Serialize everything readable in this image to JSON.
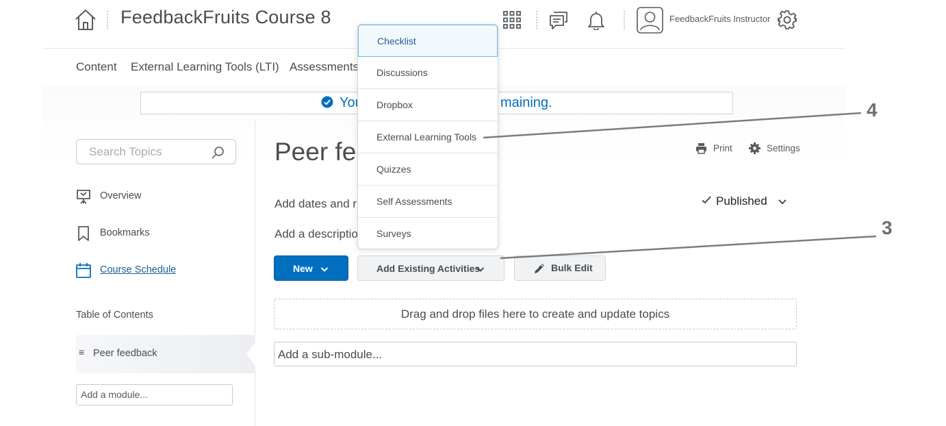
{
  "header": {
    "course_title": "FeedbackFruits Course 8",
    "username": "FeedbackFruits Instructor",
    "icons": [
      "home-icon",
      "waffle-grid-icon",
      "messages-icon",
      "notifications-bell-icon",
      "avatar",
      "gear-icon"
    ]
  },
  "nav": {
    "tabs": [
      "Content",
      "External Learning Tools (LTI)",
      "Assessments"
    ]
  },
  "notice": {
    "text_left": "You",
    "text_right": "maining."
  },
  "sidebar": {
    "search_placeholder": "Search Topics",
    "items": [
      {
        "label": "Overview",
        "icon": "presentation-icon"
      },
      {
        "label": "Bookmarks",
        "icon": "bookmark-icon"
      },
      {
        "label": "Course Schedule",
        "icon": "calendar-icon"
      }
    ],
    "toc_label": "Table of Contents",
    "toc_item": "Peer feedback",
    "add_module_placeholder": "Add a module..."
  },
  "main": {
    "title": "Peer fee",
    "print_label": "Print",
    "settings_label": "Settings",
    "dates_text": "Add dates and r",
    "description_text": "Add a descriptio",
    "status_label": "Published",
    "buttons": {
      "new": "New",
      "add_existing": "Add Existing Activities",
      "bulk_edit": "Bulk Edit"
    },
    "dropzone_text": "Drag and drop files here to create and update topics",
    "submodule_placeholder": "Add a sub-module..."
  },
  "menu": {
    "items": [
      "Checklist",
      "Discussions",
      "Dropbox",
      "External Learning Tools",
      "Quizzes",
      "Self Assessments",
      "Surveys"
    ],
    "active_index": 0
  },
  "annotations": [
    {
      "label": "4",
      "target": "External Learning Tools"
    },
    {
      "label": "3",
      "target": "Add Existing Activities"
    }
  ],
  "colors": {
    "primary": "#006fbf",
    "text": "#494c4e",
    "menu_active_bg": "#f2f9fd",
    "menu_active_border": "#74b8e6"
  }
}
